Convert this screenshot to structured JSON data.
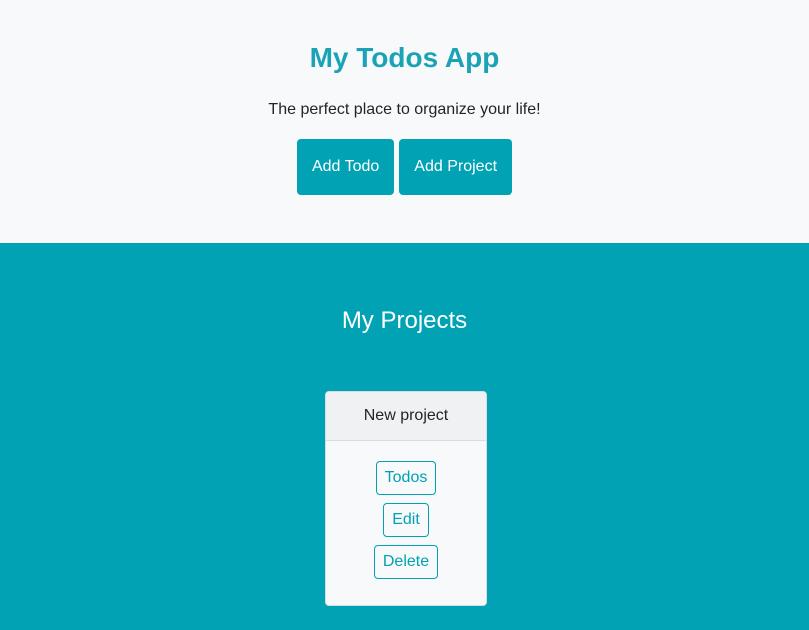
{
  "header": {
    "title": "My Todos App",
    "tagline": "The perfect place to organize your life!",
    "add_todo_label": "Add Todo",
    "add_project_label": "Add Project"
  },
  "projects_section": {
    "heading": "My Projects",
    "projects": [
      {
        "name": "New project",
        "todos_label": "Todos",
        "edit_label": "Edit",
        "delete_label": "Delete"
      }
    ]
  },
  "colors": {
    "accent": "#00a2b4",
    "title": "#1aa3b6",
    "background": "#f8f9fb"
  }
}
